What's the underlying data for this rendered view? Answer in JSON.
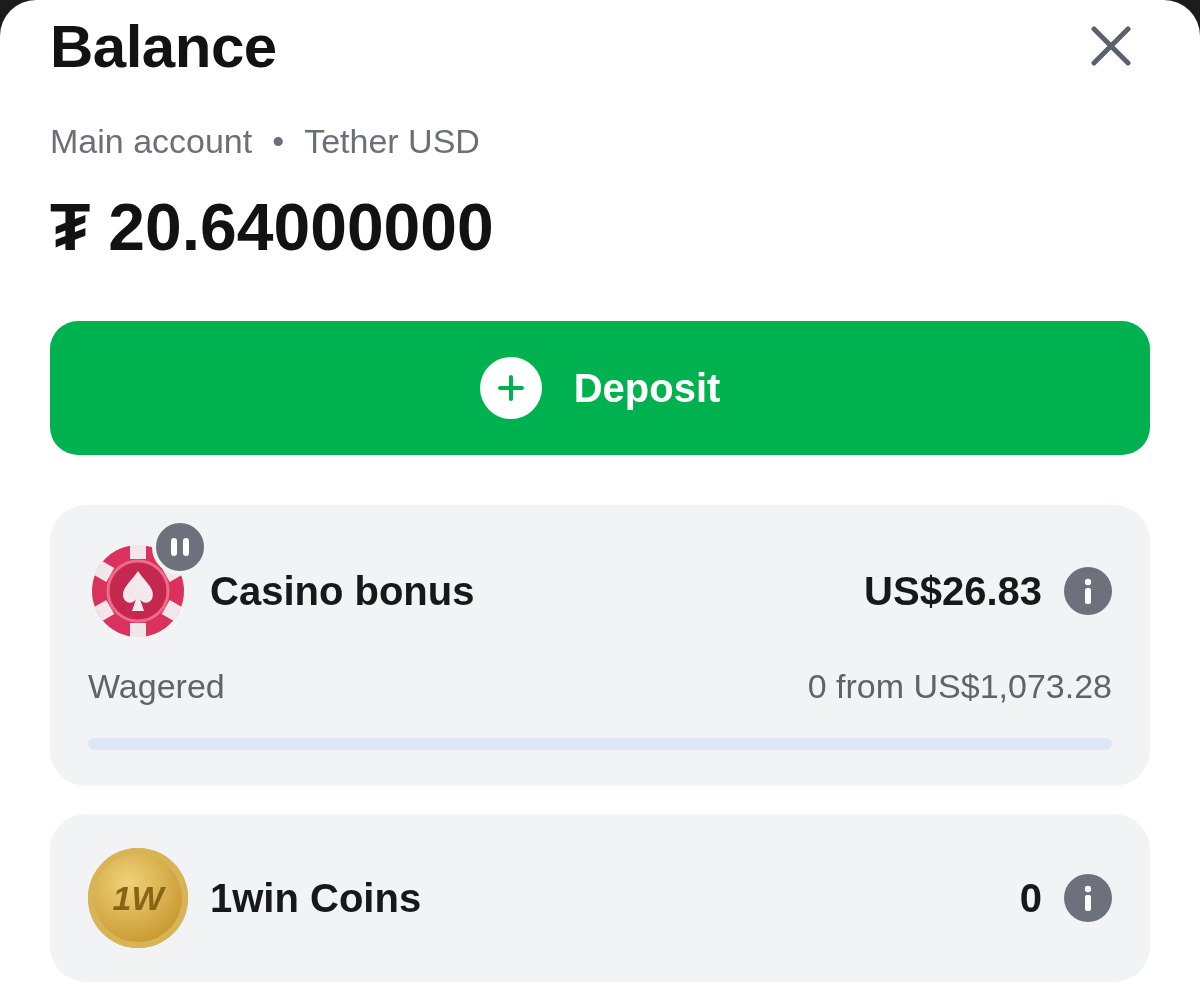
{
  "header": {
    "title": "Balance"
  },
  "account": {
    "name": "Main account",
    "separator": "•",
    "currency": "Tether USD"
  },
  "balance": {
    "symbol": "₮",
    "amount": "20.64000000"
  },
  "deposit_button": {
    "label": "Deposit"
  },
  "bonuses": [
    {
      "kind": "casino",
      "title": "Casino bonus",
      "paused": true,
      "amount": "US$26.83",
      "progress_label": "Wagered",
      "progress_text": "0 from US$1,073.28",
      "level": 0
    },
    {
      "kind": "coins",
      "title": "1win Coins",
      "paused": false,
      "coin_text": "1W",
      "amount": "0"
    }
  ]
}
